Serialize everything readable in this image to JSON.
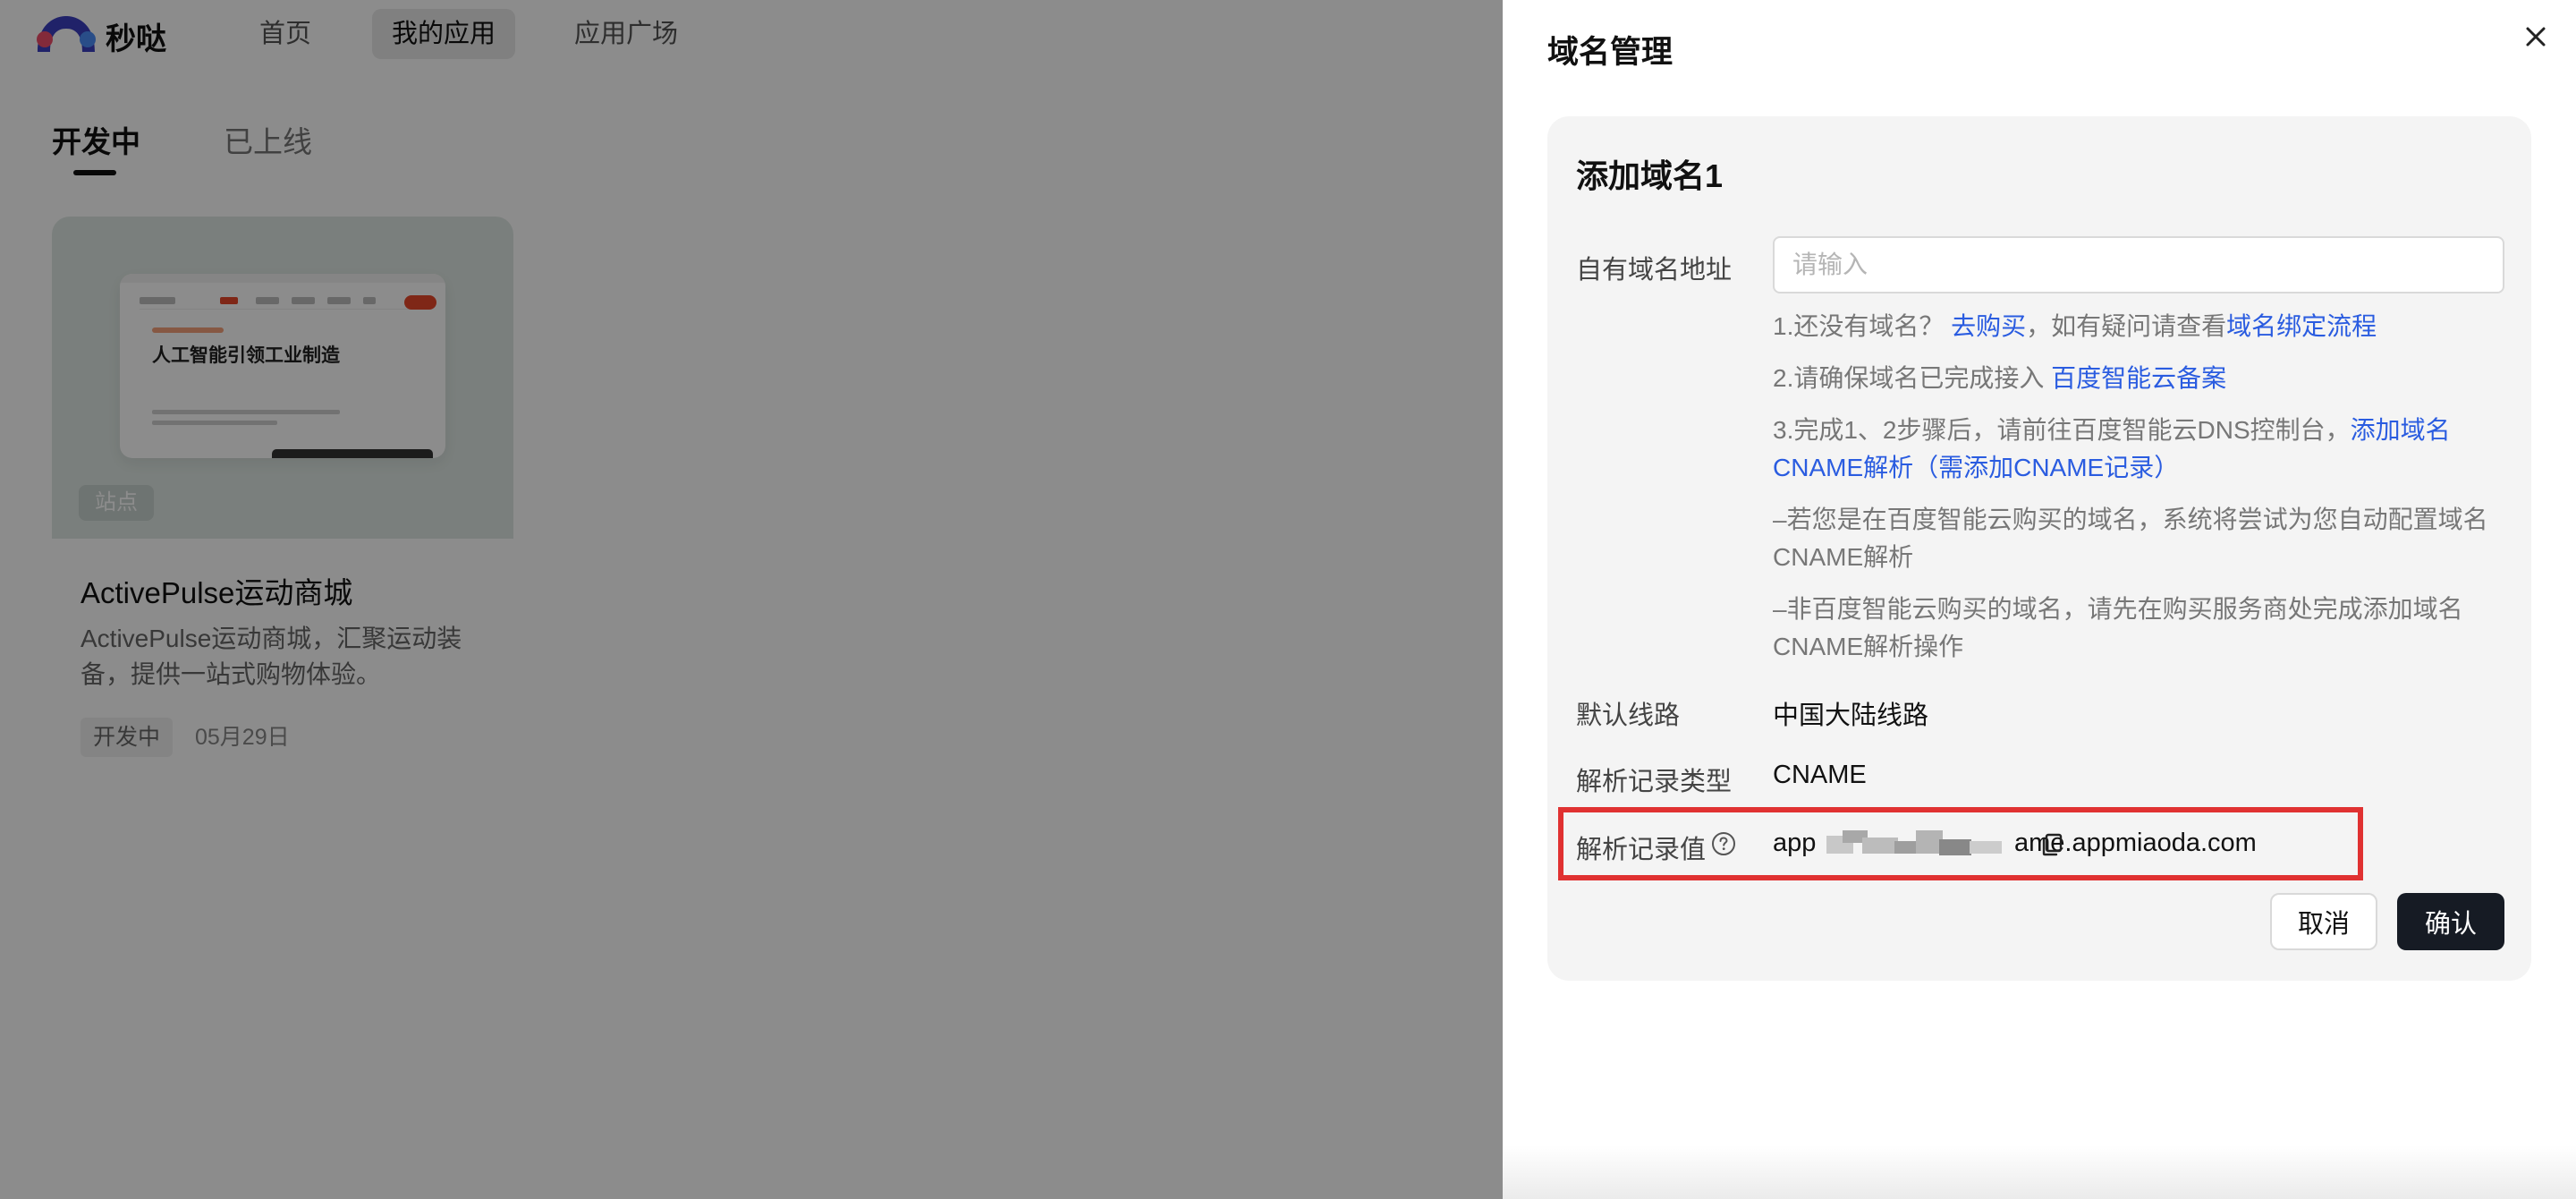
{
  "brand": {
    "name": "秒哒"
  },
  "topnav": {
    "items": [
      "首页",
      "我的应用",
      "应用广场"
    ],
    "active": "我的应用"
  },
  "tabs": {
    "items": [
      "开发中",
      "已上线"
    ],
    "active": "开发中"
  },
  "app_card": {
    "preview_heading": "人工智能引领工业制造",
    "badge": "站点",
    "title": "ActivePulse运动商城",
    "description": "ActivePulse运动商城，汇聚运动装备，提供一站式购物体验。",
    "status": "开发中",
    "date": "05月29日"
  },
  "drawer": {
    "title": "域名管理",
    "form": {
      "title": "添加域名1",
      "domain_label": "自有域名地址",
      "domain_placeholder": "请输入",
      "domain_value": "",
      "hint1": {
        "text": "1.还没有域名？",
        "link1": "去购买",
        "middle": "，如有疑问请查看",
        "link2": "域名绑定流程"
      },
      "hint2": {
        "text": "2.请确保域名已完成接入 ",
        "link": "百度智能云备案"
      },
      "hint3": {
        "text": "3.完成1、2步骤后，请前往百度智能云DNS控制台，",
        "link": "添加域名CNAME解析（需添加CNAME记录）"
      },
      "hint4": "–若您是在百度智能云购买的域名，系统将尝试为您自动配置域名CNAME解析",
      "hint5": "–非百度智能云购买的域名，请先在购买服务商处完成添加域名CNAME解析操作",
      "line_label": "默认线路",
      "line_value": "中国大陆线路",
      "type_label": "解析记录类型",
      "type_value": "CNAME",
      "record_label": "解析记录值",
      "record_prefix": "app",
      "record_suffix": "ame.appmiaoda.com",
      "cancel": "取消",
      "confirm": "确认"
    }
  },
  "colors": {
    "accent_link": "#2a5ce0",
    "primary_button": "#161b24",
    "highlight": "#e03131",
    "mask": "rgba(0,0,0,0.45)"
  },
  "icons": [
    "close-icon",
    "help-icon",
    "copy-icon",
    "logo-icon"
  ]
}
